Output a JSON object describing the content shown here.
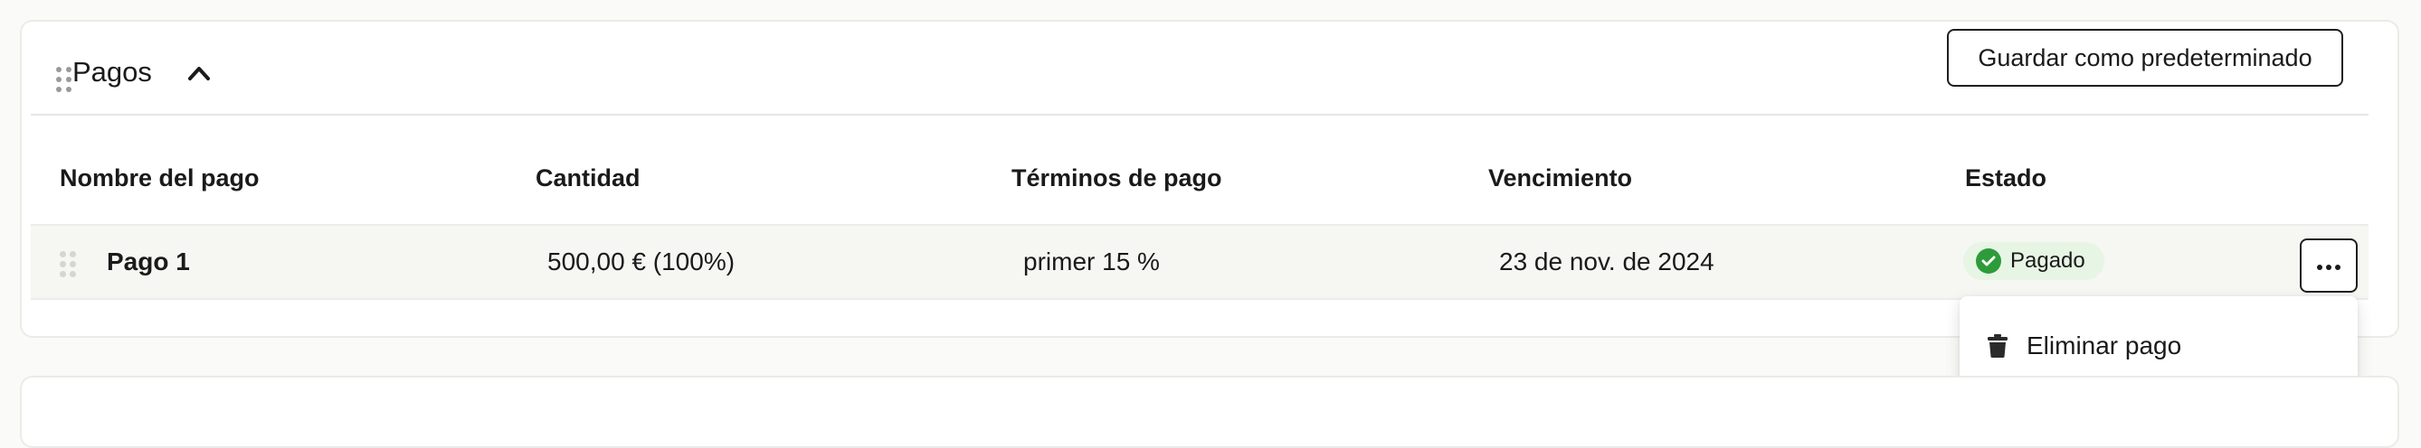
{
  "section": {
    "title": "Pagos",
    "save_default_label": "Guardar como predeterminado"
  },
  "table": {
    "columns": [
      "Nombre del pago",
      "Cantidad",
      "Términos de pago",
      "Vencimiento",
      "Estado"
    ],
    "rows": [
      {
        "name": "Pago 1",
        "amount": "500,00 € (100%)",
        "terms": "primer 15 %",
        "due": "23 de nov. de 2024",
        "status": "Pagado"
      }
    ]
  },
  "row_menu": {
    "items": [
      {
        "label": "Eliminar pago",
        "icon": "trash-icon"
      }
    ]
  },
  "colors": {
    "status_paid": "#2e9b3a",
    "status_paid_bg": "#e7f5e4"
  }
}
